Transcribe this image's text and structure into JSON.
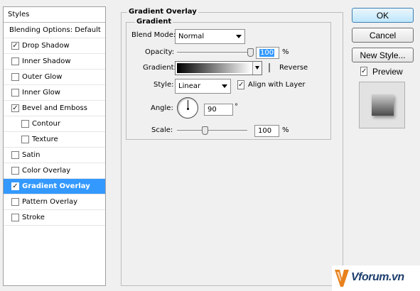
{
  "styles_list": {
    "header": "Styles",
    "items": [
      {
        "label": "Blending Options: Default",
        "has_checkbox": false,
        "checked": false,
        "indent": false,
        "selected": false
      },
      {
        "label": "Drop Shadow",
        "has_checkbox": true,
        "checked": true,
        "indent": false,
        "selected": false
      },
      {
        "label": "Inner Shadow",
        "has_checkbox": true,
        "checked": false,
        "indent": false,
        "selected": false
      },
      {
        "label": "Outer Glow",
        "has_checkbox": true,
        "checked": false,
        "indent": false,
        "selected": false
      },
      {
        "label": "Inner Glow",
        "has_checkbox": true,
        "checked": false,
        "indent": false,
        "selected": false
      },
      {
        "label": "Bevel and Emboss",
        "has_checkbox": true,
        "checked": true,
        "indent": false,
        "selected": false
      },
      {
        "label": "Contour",
        "has_checkbox": true,
        "checked": false,
        "indent": true,
        "selected": false
      },
      {
        "label": "Texture",
        "has_checkbox": true,
        "checked": false,
        "indent": true,
        "selected": false
      },
      {
        "label": "Satin",
        "has_checkbox": true,
        "checked": false,
        "indent": false,
        "selected": false
      },
      {
        "label": "Color Overlay",
        "has_checkbox": true,
        "checked": false,
        "indent": false,
        "selected": false
      },
      {
        "label": "Gradient Overlay",
        "has_checkbox": true,
        "checked": true,
        "indent": false,
        "selected": true
      },
      {
        "label": "Pattern Overlay",
        "has_checkbox": true,
        "checked": false,
        "indent": false,
        "selected": false
      },
      {
        "label": "Stroke",
        "has_checkbox": true,
        "checked": false,
        "indent": false,
        "selected": false
      }
    ]
  },
  "panel": {
    "title": "Gradient Overlay",
    "group_title": "Gradient",
    "blend_mode": {
      "label": "Blend Mode:",
      "value": "Normal"
    },
    "opacity": {
      "label": "Opacity:",
      "value": "100",
      "unit": "%",
      "fraction": 1.0
    },
    "gradient": {
      "label": "Gradient:",
      "reverse_label": "Reverse",
      "reverse_checked": false
    },
    "style": {
      "label": "Style:",
      "value": "Linear",
      "align_label": "Align with Layer",
      "align_checked": true
    },
    "angle": {
      "label": "Angle:",
      "value": "90",
      "unit": "°"
    },
    "scale": {
      "label": "Scale:",
      "value": "100",
      "unit": "%",
      "fraction": 0.4
    }
  },
  "buttons": {
    "ok": "OK",
    "cancel": "Cancel",
    "new_style": "New Style..."
  },
  "preview": {
    "label": "Preview",
    "checked": true
  },
  "watermark": {
    "text": "Vforum.vn"
  },
  "colors": {
    "selection": "#3399ff",
    "watermark_orange": "#e8821e"
  }
}
